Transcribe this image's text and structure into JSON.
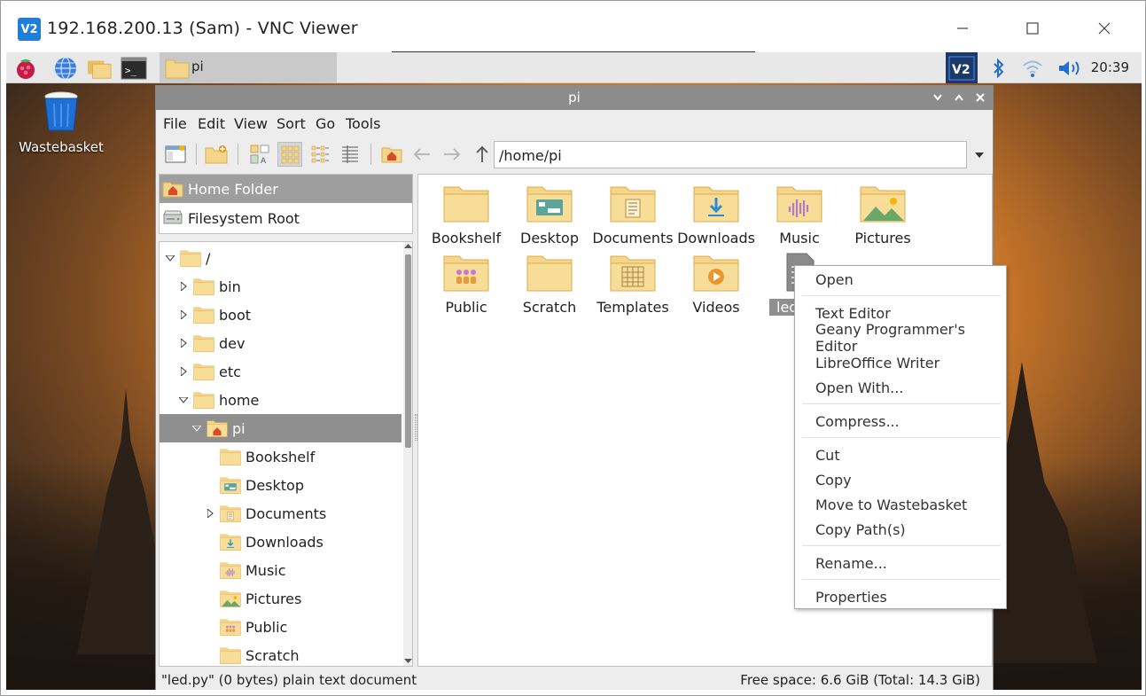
{
  "vnc": {
    "title": "192.168.200.13 (Sam) - VNC Viewer",
    "logo_text": "V2",
    "controls": [
      "minimize-icon",
      "maximize-icon",
      "close-icon"
    ]
  },
  "taskbar": {
    "task_label": "pi",
    "clock": "20:39",
    "tray_icons": [
      "vnc-icon",
      "bluetooth-icon",
      "wifi-icon",
      "volume-icon"
    ]
  },
  "desktop": {
    "wastebasket_label": "Wastebasket"
  },
  "file_manager": {
    "title": "pi",
    "menu": [
      "File",
      "Edit",
      "View",
      "Sort",
      "Go",
      "Tools"
    ],
    "path": "/home/pi",
    "places": [
      {
        "label": "Home Folder",
        "icon": "home-folder-icon",
        "selected": true
      },
      {
        "label": "Filesystem Root",
        "icon": "drive-icon",
        "selected": false
      }
    ],
    "tree": [
      {
        "label": "/",
        "depth": 0,
        "expander": "open",
        "icon": "folder"
      },
      {
        "label": "bin",
        "depth": 1,
        "expander": "closed",
        "icon": "folder"
      },
      {
        "label": "boot",
        "depth": 1,
        "expander": "closed",
        "icon": "folder"
      },
      {
        "label": "dev",
        "depth": 1,
        "expander": "closed",
        "icon": "folder"
      },
      {
        "label": "etc",
        "depth": 1,
        "expander": "closed",
        "icon": "folder"
      },
      {
        "label": "home",
        "depth": 1,
        "expander": "open",
        "icon": "folder"
      },
      {
        "label": "pi",
        "depth": 2,
        "expander": "open",
        "icon": "home",
        "selected": true
      },
      {
        "label": "Bookshelf",
        "depth": 3,
        "expander": "",
        "icon": "folder"
      },
      {
        "label": "Desktop",
        "depth": 3,
        "expander": "",
        "icon": "desktop"
      },
      {
        "label": "Documents",
        "depth": 3,
        "expander": "closed",
        "icon": "documents"
      },
      {
        "label": "Downloads",
        "depth": 3,
        "expander": "",
        "icon": "downloads"
      },
      {
        "label": "Music",
        "depth": 3,
        "expander": "",
        "icon": "music"
      },
      {
        "label": "Pictures",
        "depth": 3,
        "expander": "",
        "icon": "pictures"
      },
      {
        "label": "Public",
        "depth": 3,
        "expander": "",
        "icon": "public"
      },
      {
        "label": "Scratch",
        "depth": 3,
        "expander": "",
        "icon": "folder"
      }
    ],
    "items": [
      {
        "label": "Bookshelf",
        "icon": "folder"
      },
      {
        "label": "Desktop",
        "icon": "desktop"
      },
      {
        "label": "Documents",
        "icon": "documents"
      },
      {
        "label": "Downloads",
        "icon": "downloads"
      },
      {
        "label": "Music",
        "icon": "music"
      },
      {
        "label": "Pictures",
        "icon": "pictures"
      },
      {
        "label": "Public",
        "icon": "public"
      },
      {
        "label": "Scratch",
        "icon": "folder"
      },
      {
        "label": "Templates",
        "icon": "templates"
      },
      {
        "label": "Videos",
        "icon": "videos"
      },
      {
        "label": "led",
        "icon": "text-file",
        "selected": true
      }
    ],
    "status_left": "\"led.py\" (0 bytes) plain text document",
    "status_right": "Free space: 6.6 GiB (Total: 14.3 GiB)"
  },
  "context_menu": {
    "items": [
      "Open",
      "Text Editor",
      "Geany Programmer's Editor",
      "LibreOffice Writer",
      "Open With...",
      "Compress...",
      "Cut",
      "Copy",
      "Move to Wastebasket",
      "Copy Path(s)",
      "Rename...",
      "Properties"
    ]
  },
  "colors": {
    "folder": "#f5d58a",
    "folder_dark": "#e9bf5f",
    "selection": "#8f8f8f",
    "titlebar": "#8c8c8c",
    "vnc_blue": "#1f7fd8"
  }
}
